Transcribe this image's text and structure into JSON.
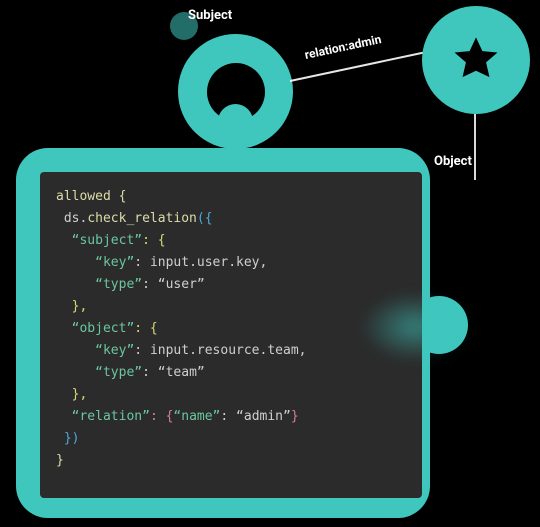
{
  "subject_label": "Subject",
  "object_label": "Object",
  "relation_edge_label": "relation:admin",
  "icons": {
    "object": "star"
  },
  "colors": {
    "accent": "#3FC7BE",
    "editor_bg": "#2B2B2B"
  },
  "code": {
    "l1_allowed": "allowed {",
    "l2_prefix": " ds",
    "l2_dot": ".",
    "l2_fn": "check_relation",
    "l2_open": "({",
    "l3_indent": "  ",
    "l3_key": "“subject”",
    "l3_colon": ": {",
    "l4_indent": "     ",
    "l4_key": "“key”",
    "l4_colon": ": ",
    "l4_val": "input.user.key",
    "l4_comma": ",",
    "l5_indent": "     ",
    "l5_key": "“type”",
    "l5_colon": ": ",
    "l5_val": "“user”",
    "l6": "  },",
    "l7_indent": "  ",
    "l7_key": "“object”",
    "l7_colon": ": {",
    "l8_indent": "     ",
    "l8_key": "“key”",
    "l8_colon": ": ",
    "l8_val": "input.resource.team",
    "l8_comma": ",",
    "l9_indent": "     ",
    "l9_key": "“type”",
    "l9_colon": ": ",
    "l9_val": "“team”",
    "l10": "  },",
    "l11_indent": "  ",
    "l11_key": "“relation”",
    "l11_colon": ": {",
    "l11_name_key": "“name”",
    "l11_name_colon": ": ",
    "l11_name_val": "“admin”",
    "l11_close": "}",
    "l12": " })",
    "l13": "}"
  }
}
